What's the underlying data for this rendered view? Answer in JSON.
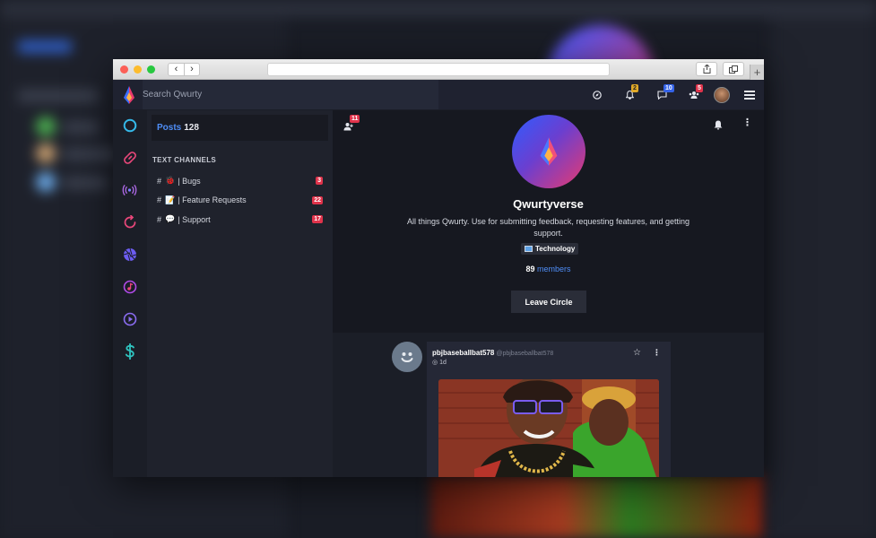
{
  "header": {
    "search_placeholder": "Search Qwurty"
  },
  "notifications": {
    "bell_count": "2",
    "messages_count": "10",
    "members_count": "5"
  },
  "channels_panel": {
    "posts_label": "Posts",
    "posts_count": "128",
    "section_title": "TEXT CHANNELS",
    "items": [
      {
        "hash": "#",
        "emoji": "🐞",
        "label": "| Bugs",
        "count": "3"
      },
      {
        "hash": "#",
        "emoji": "📝",
        "label": "| Feature Requests",
        "count": "22"
      },
      {
        "hash": "#",
        "emoji": "💬",
        "label": "| Support",
        "count": "17"
      }
    ]
  },
  "community": {
    "members_icon_badge": "11",
    "name": "Qwurtyverse",
    "description": "All things Qwurty. Use for submitting feedback, requesting features, and getting support.",
    "tag_label": "Technology",
    "member_count": "89",
    "member_label": "members",
    "leave_label": "Leave Circle"
  },
  "post": {
    "author": "pbjbaseballbat578",
    "handle": "@pbjbaseballbat578",
    "time": "1d"
  },
  "colors": {
    "accent_blue": "#4f8ef7",
    "badge_red": "#e0334b",
    "badge_yellow": "#e0a928",
    "badge_blue": "#3563e8"
  }
}
